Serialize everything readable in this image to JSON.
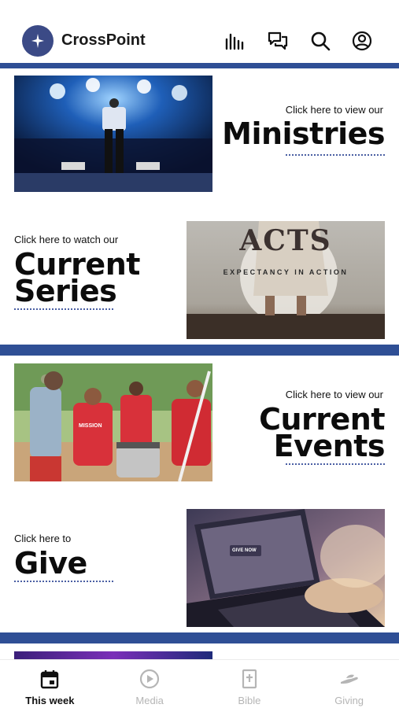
{
  "header": {
    "app_name": "CrossPoint",
    "icons": [
      "equalizer-icon",
      "chat-icon",
      "search-icon",
      "account-icon"
    ]
  },
  "tiles": [
    {
      "small": "Click here to view our",
      "big": "Ministries"
    },
    {
      "small": "Click here to watch our",
      "big_line1": "Current",
      "big_line2": "Series",
      "image_title": "ACTS",
      "image_subtitle": "EXPECTANCY IN ACTION"
    },
    {
      "small": "Click here to view our",
      "big_line1": "Current",
      "big_line2": "Events",
      "shirt_text": "MISSION"
    },
    {
      "small": "Click here to",
      "big": "Give",
      "screen_text": "GIVE NOW"
    }
  ],
  "tabbar": {
    "items": [
      {
        "label": "This week",
        "icon": "calendar-icon",
        "active": true
      },
      {
        "label": "Media",
        "icon": "play-circle-icon",
        "active": false
      },
      {
        "label": "Bible",
        "icon": "bible-icon",
        "active": false
      },
      {
        "label": "Giving",
        "icon": "giving-hand-icon",
        "active": false
      }
    ]
  },
  "colors": {
    "accent_band": "#2f4f95",
    "logo_bg": "#3b4a86"
  }
}
